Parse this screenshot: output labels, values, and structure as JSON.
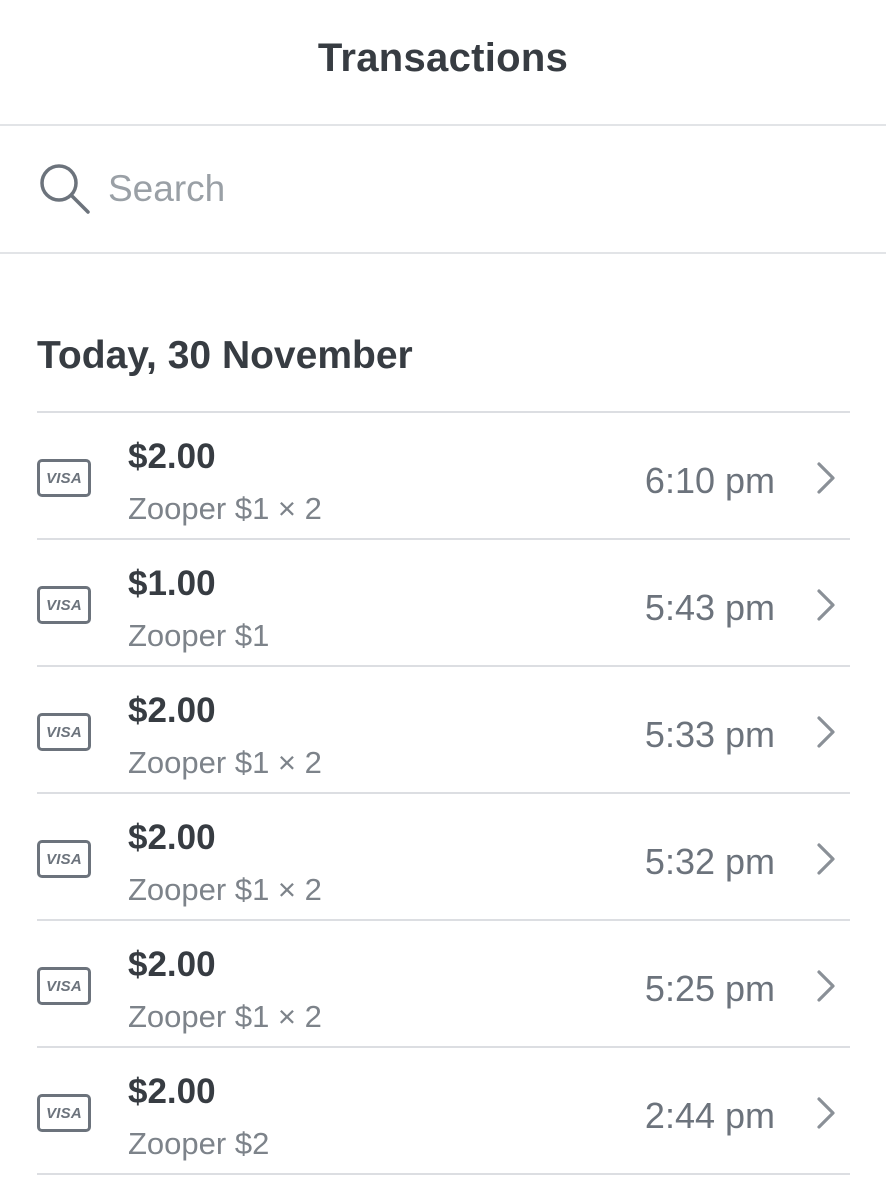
{
  "header": {
    "title": "Transactions"
  },
  "search": {
    "placeholder": "Search",
    "value": "",
    "icon": "search-icon"
  },
  "section": {
    "title": "Today, 30 November"
  },
  "transactions": [
    {
      "amount": "$2.00",
      "description": "Zooper $1 × 2",
      "time": "6:10 pm",
      "card": "VISA"
    },
    {
      "amount": "$1.00",
      "description": "Zooper $1",
      "time": "5:43 pm",
      "card": "VISA"
    },
    {
      "amount": "$2.00",
      "description": "Zooper $1 × 2",
      "time": "5:33 pm",
      "card": "VISA"
    },
    {
      "amount": "$2.00",
      "description": "Zooper $1 × 2",
      "time": "5:32 pm",
      "card": "VISA"
    },
    {
      "amount": "$2.00",
      "description": "Zooper $1 × 2",
      "time": "5:25 pm",
      "card": "VISA"
    },
    {
      "amount": "$2.00",
      "description": "Zooper $2",
      "time": "2:44 pm",
      "card": "VISA"
    }
  ],
  "colors": {
    "text_primary": "#373c42",
    "text_secondary": "#7d838a",
    "icon": "#6c737c",
    "divider": "#dcdee2"
  }
}
